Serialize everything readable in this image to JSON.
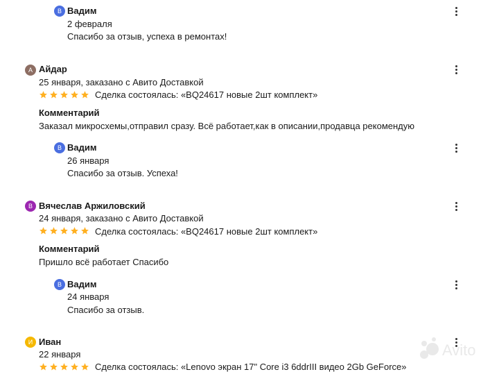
{
  "reviews": [
    {
      "reply": {
        "avatar_letter": "В",
        "name": "Вадим",
        "date": "2 февраля",
        "text": "Спасибо за отзыв, успеха в ремонтах!"
      }
    },
    {
      "avatar_letter": "А",
      "avatar_color": "#8d6e63",
      "name": "Айдар",
      "meta": "25 января, заказано с Авито Доставкой",
      "rating": 5,
      "deal": "Сделка состоялась: «BQ24617 новые 2шт комплект»",
      "comment_heading": "Комментарий",
      "comment": "Заказал микросхемы,отправил сразу. Всё работает,как в описании,продавца рекомендую",
      "reply": {
        "avatar_letter": "В",
        "name": "Вадим",
        "date": "26 января",
        "text": "Спасибо за отзыв. Успеха!"
      }
    },
    {
      "avatar_letter": "В",
      "avatar_color": "#9c27b0",
      "name": "Вячеслав Аржиловский",
      "meta": "24 января, заказано с Авито Доставкой",
      "rating": 5,
      "deal": "Сделка состоялась: «BQ24617 новые 2шт комплект»",
      "comment_heading": "Комментарий",
      "comment": "Пришло всё работает Спасибо",
      "reply": {
        "avatar_letter": "В",
        "name": "Вадим",
        "date": "24 января",
        "text": "Спасибо за отзыв."
      }
    },
    {
      "avatar_letter": "И",
      "avatar_color": "#f5b800",
      "name": "Иван",
      "meta": "22 января",
      "rating": 5,
      "deal": "Сделка состоялась: «Lenovo экран 17\" Core i3 6ddrIII видео 2Gb GeForce»"
    }
  ],
  "colors": {
    "reply_avatar": "#4a6ee0",
    "star": "#ffb021",
    "menu_dots": "#333333"
  },
  "watermark": "Avito"
}
